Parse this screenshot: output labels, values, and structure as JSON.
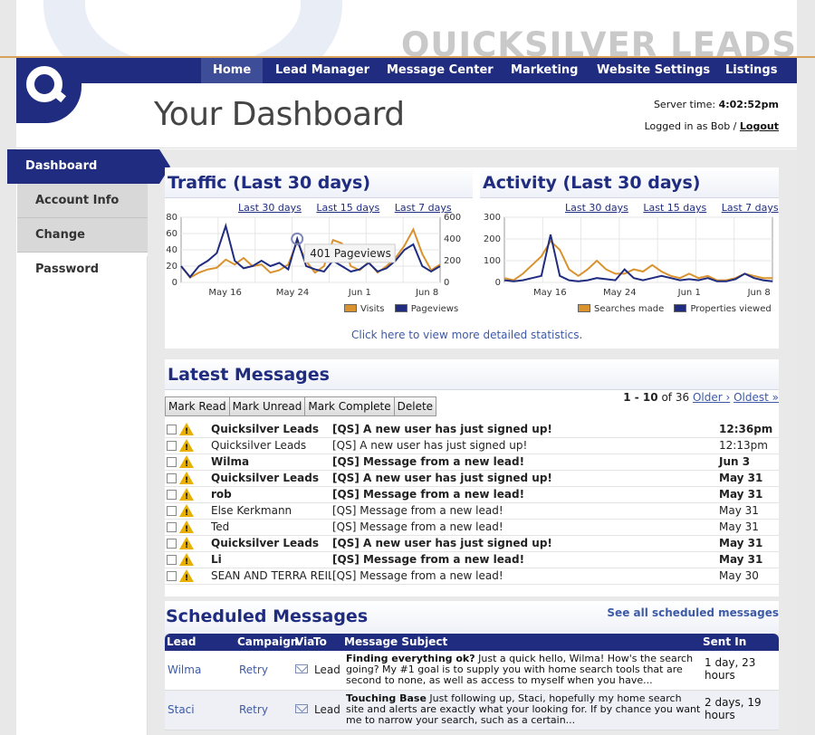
{
  "brand": {
    "name": "QUICKSILVER LEADS"
  },
  "nav": {
    "items": [
      {
        "label": "Home",
        "active": true
      },
      {
        "label": "Lead Manager"
      },
      {
        "label": "Message Center"
      },
      {
        "label": "Marketing"
      },
      {
        "label": "Website Settings"
      },
      {
        "label": "Listings"
      }
    ]
  },
  "header": {
    "title": "Your Dashboard",
    "server_time_label": "Server time:",
    "server_time": "4:02:52pm",
    "logged_in": "Logged in as Bob /",
    "logout": "Logout"
  },
  "sidebar": {
    "items": [
      {
        "label": "Dashboard",
        "active": true
      },
      {
        "label": "Account Info"
      },
      {
        "label": "Change Password"
      }
    ]
  },
  "traffic": {
    "title": "Traffic (Last 30 days)",
    "ranges": [
      "Last 30 days",
      "Last 15 days",
      "Last 7 days"
    ],
    "tooltip": "401 Pageviews",
    "legend": [
      "Visits",
      "Pageviews"
    ]
  },
  "activity": {
    "title": "Activity (Last 30 days)",
    "ranges": [
      "Last 30 days",
      "Last 15 days",
      "Last 7 days"
    ],
    "legend": [
      "Searches made",
      "Properties viewed"
    ]
  },
  "stats_link": "Click here to view more detailed statistics.",
  "chart_data": [
    {
      "type": "line",
      "title": "Traffic (Last 30 days)",
      "x_ticks": [
        "May 16",
        "May 24",
        "Jun 1",
        "Jun 8"
      ],
      "ylim_left": [
        0,
        80
      ],
      "ylim_right": [
        0,
        600
      ],
      "y_ticks_left": [
        0,
        20,
        40,
        60,
        80
      ],
      "y_ticks_right": [
        0,
        200,
        400,
        600
      ],
      "grid": true,
      "series": [
        {
          "name": "Visits",
          "color": "#d9922e",
          "axis": "left",
          "values": [
            20,
            6,
            12,
            16,
            18,
            28,
            22,
            30,
            20,
            22,
            12,
            15,
            22,
            50,
            26,
            12,
            20,
            52,
            48,
            20,
            15,
            25,
            12,
            20,
            30,
            45,
            65,
            35,
            15,
            22
          ]
        },
        {
          "name": "Pageviews",
          "color": "#1f2c7f",
          "axis": "right",
          "values": [
            150,
            50,
            150,
            200,
            270,
            520,
            200,
            130,
            150,
            200,
            150,
            180,
            120,
            401,
            150,
            120,
            100,
            200,
            150,
            100,
            120,
            180,
            100,
            130,
            200,
            300,
            350,
            150,
            100,
            150
          ]
        }
      ]
    },
    {
      "type": "line",
      "title": "Activity (Last 30 days)",
      "x_ticks": [
        "May 16",
        "May 24",
        "Jun 1",
        "Jun 8"
      ],
      "ylim": [
        0,
        300
      ],
      "y_ticks": [
        0,
        100,
        200,
        300
      ],
      "grid": true,
      "series": [
        {
          "name": "Searches made",
          "color": "#d9922e",
          "values": [
            20,
            10,
            40,
            80,
            120,
            190,
            150,
            60,
            30,
            60,
            100,
            60,
            40,
            40,
            60,
            50,
            80,
            50,
            30,
            20,
            40,
            20,
            30,
            10,
            10,
            20,
            40,
            30,
            20,
            20
          ]
        },
        {
          "name": "Properties viewed",
          "color": "#1f2c7f",
          "values": [
            10,
            5,
            10,
            20,
            30,
            220,
            30,
            10,
            5,
            10,
            20,
            15,
            10,
            60,
            20,
            10,
            20,
            30,
            20,
            10,
            15,
            10,
            20,
            5,
            5,
            15,
            40,
            20,
            10,
            5
          ]
        }
      ]
    }
  ],
  "messages": {
    "title": "Latest Messages",
    "actions": [
      "Mark Read",
      "Mark Unread",
      "Mark Complete",
      "Delete"
    ],
    "pager": {
      "range": "1 - 10",
      "of": "of 36",
      "older": "Older ›",
      "oldest": "Oldest »"
    },
    "rows": [
      {
        "from": "Quicksilver Leads",
        "subject": "[QS] A new user has just signed up!",
        "time": "12:36pm",
        "unread": true
      },
      {
        "from": "Quicksilver Leads",
        "subject": "[QS] A new user has just signed up!",
        "time": "12:13pm",
        "unread": false
      },
      {
        "from": "Wilma",
        "subject": "[QS] Message from a new lead!",
        "time": "Jun 3",
        "unread": true
      },
      {
        "from": "Quicksilver Leads",
        "subject": "[QS] A new user has just signed up!",
        "time": "May 31",
        "unread": true
      },
      {
        "from": "rob",
        "subject": "[QS] Message from a new lead!",
        "time": "May 31",
        "unread": true
      },
      {
        "from": "Else Kerkmann",
        "subject": "[QS] Message from a new lead!",
        "time": "May 31",
        "unread": false
      },
      {
        "from": "Ted",
        "subject": "[QS] Message from a new lead!",
        "time": "May 31",
        "unread": false
      },
      {
        "from": "Quicksilver Leads",
        "subject": "[QS] A new user has just signed up!",
        "time": "May 31",
        "unread": true
      },
      {
        "from": "Li",
        "subject": "[QS] Message from a new lead!",
        "time": "May 31",
        "unread": true
      },
      {
        "from": "SEAN AND TERRA REILLY",
        "subject": "[QS] Message from a new lead!",
        "time": "May 30",
        "unread": false
      }
    ]
  },
  "scheduled": {
    "title": "Scheduled Messages",
    "see_all": "See all scheduled messages",
    "headers": {
      "lead": "Lead",
      "campaign": "Campaign",
      "via": "Via",
      "to": "To",
      "subject": "Message Subject",
      "sent": "Sent In"
    },
    "rows": [
      {
        "lead": "Wilma",
        "campaign": "Retry",
        "to": "Lead",
        "subject_title": "Finding everything ok?",
        "subject_body": "Just a quick hello, Wilma! How's the search going? My #1 goal is to supply you with home search tools that are second to none, as well as access to myself when you have...",
        "sent": "1 day, 23 hours"
      },
      {
        "lead": "Staci",
        "campaign": "Retry",
        "to": "Lead",
        "subject_title": "Touching Base",
        "subject_body": "Just following up, Staci, hopefully my home search site and alerts are exactly what your looking for. If by chance you want me to narrow your search, such as a certain...",
        "sent": "2 days, 19 hours"
      }
    ]
  }
}
